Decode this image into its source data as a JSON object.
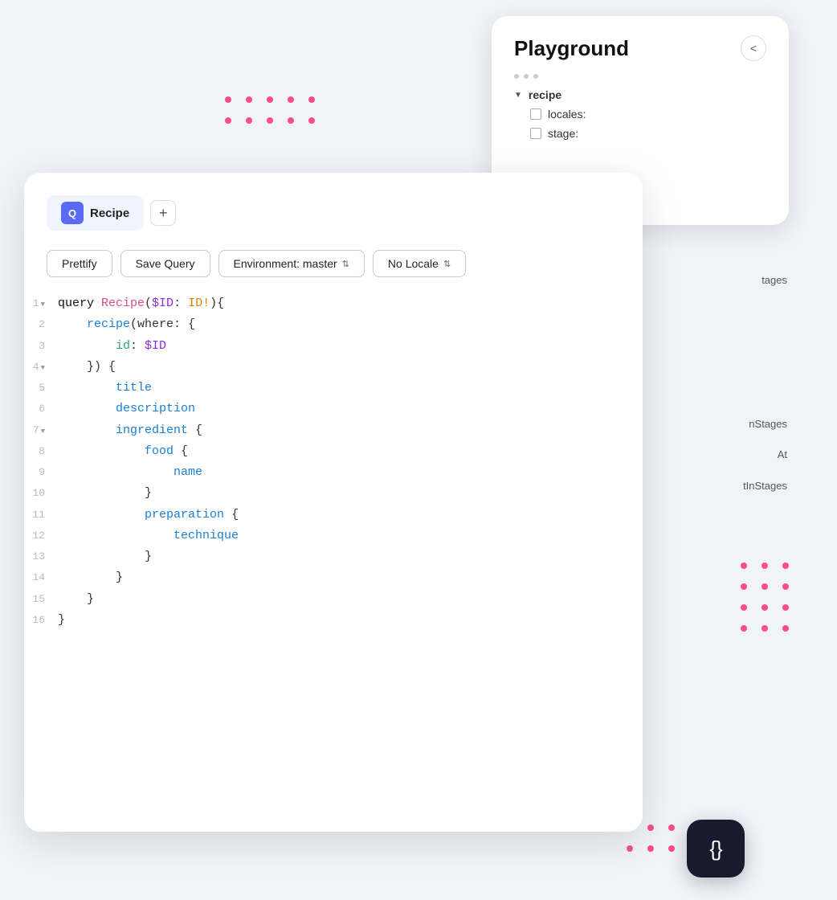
{
  "playground": {
    "title": "Playground",
    "close_label": "<",
    "tree": {
      "parent": "recipe",
      "children": [
        {
          "label": "locales:"
        },
        {
          "label": "stage:"
        }
      ]
    }
  },
  "editor": {
    "tab_label": "Recipe",
    "tab_icon": "Q",
    "add_tab_label": "+",
    "toolbar": {
      "prettify": "Prettify",
      "save_query": "Save Query",
      "environment": "Environment: master",
      "locale": "No Locale"
    },
    "code_lines": [
      {
        "num": "1",
        "fold": "▼",
        "content": [
          {
            "t": "kw",
            "v": "query "
          },
          {
            "t": "fn-name",
            "v": "Recipe"
          },
          {
            "t": "punct",
            "v": "("
          },
          {
            "t": "param",
            "v": "$ID"
          },
          {
            "t": "punct",
            "v": ": "
          },
          {
            "t": "type",
            "v": "ID!"
          },
          {
            "t": "punct",
            "v": "){"
          }
        ]
      },
      {
        "num": "2",
        "fold": "",
        "content": [
          {
            "t": "indent",
            "v": "    "
          },
          {
            "t": "field",
            "v": "recipe"
          },
          {
            "t": "punct",
            "v": "(where: {"
          }
        ]
      },
      {
        "num": "3",
        "fold": "",
        "content": [
          {
            "t": "indent",
            "v": "        "
          },
          {
            "t": "field-green",
            "v": "id"
          },
          {
            "t": "punct",
            "v": ": "
          },
          {
            "t": "param",
            "v": "$ID"
          }
        ]
      },
      {
        "num": "4",
        "fold": "▼",
        "content": [
          {
            "t": "indent",
            "v": "    "
          },
          {
            "t": "punct",
            "v": "}) {"
          }
        ]
      },
      {
        "num": "5",
        "fold": "",
        "content": [
          {
            "t": "indent",
            "v": "        "
          },
          {
            "t": "field",
            "v": "title"
          }
        ]
      },
      {
        "num": "6",
        "fold": "",
        "content": [
          {
            "t": "indent",
            "v": "        "
          },
          {
            "t": "field",
            "v": "description"
          }
        ]
      },
      {
        "num": "7",
        "fold": "▼",
        "content": [
          {
            "t": "indent",
            "v": "        "
          },
          {
            "t": "field",
            "v": "ingredient"
          },
          {
            "t": "punct",
            "v": " {"
          }
        ]
      },
      {
        "num": "8",
        "fold": "",
        "content": [
          {
            "t": "indent",
            "v": "            "
          },
          {
            "t": "field",
            "v": "food"
          },
          {
            "t": "punct",
            "v": " {"
          }
        ]
      },
      {
        "num": "9",
        "fold": "",
        "content": [
          {
            "t": "indent",
            "v": "                "
          },
          {
            "t": "field",
            "v": "name"
          }
        ]
      },
      {
        "num": "10",
        "fold": "",
        "content": [
          {
            "t": "indent",
            "v": "            "
          },
          {
            "t": "punct",
            "v": "}"
          }
        ]
      },
      {
        "num": "11",
        "fold": "",
        "content": [
          {
            "t": "indent",
            "v": "            "
          },
          {
            "t": "field",
            "v": "preparation"
          },
          {
            "t": "punct",
            "v": " {"
          }
        ]
      },
      {
        "num": "12",
        "fold": "",
        "content": [
          {
            "t": "indent",
            "v": "                "
          },
          {
            "t": "field",
            "v": "technique"
          }
        ]
      },
      {
        "num": "13",
        "fold": "",
        "content": [
          {
            "t": "indent",
            "v": "            "
          },
          {
            "t": "punct",
            "v": "}"
          }
        ]
      },
      {
        "num": "14",
        "fold": "",
        "content": [
          {
            "t": "indent",
            "v": "        "
          },
          {
            "t": "punct",
            "v": "}"
          }
        ]
      },
      {
        "num": "15",
        "fold": "",
        "content": [
          {
            "t": "indent",
            "v": "    "
          },
          {
            "t": "punct",
            "v": "}"
          }
        ]
      },
      {
        "num": "16",
        "fold": "",
        "content": [
          {
            "t": "punct",
            "v": "}"
          }
        ]
      }
    ]
  },
  "right_panel_items": [
    "stages",
    "nStages",
    "At",
    "tInStages"
  ],
  "badge": {
    "icon": "{}"
  },
  "dots": {
    "top_count": 10,
    "right_count": 12,
    "bottom_count": 10
  }
}
